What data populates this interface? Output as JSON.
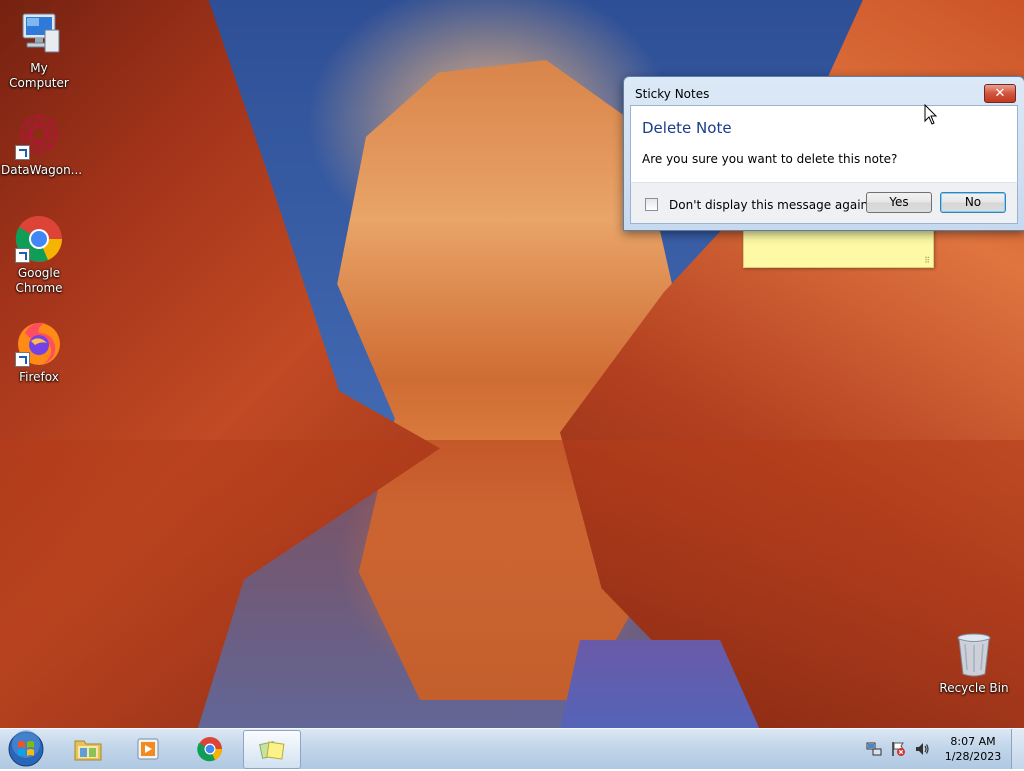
{
  "desktop": {
    "icons": [
      {
        "label": "My Computer"
      },
      {
        "label": "DataWagon..."
      },
      {
        "label": "Google Chrome"
      },
      {
        "label": "Firefox"
      },
      {
        "label": "Recycle Bin"
      }
    ]
  },
  "dialog": {
    "title": "Sticky Notes",
    "close_label": "✕",
    "heading": "Delete Note",
    "message": "Are you sure you want to delete this note?",
    "checkbox_label": "Don't display this message again",
    "checkbox_checked": false,
    "yes_label": "Yes",
    "no_label": "No"
  },
  "taskbar": {
    "pinned": [
      {
        "name": "windows-explorer",
        "icon": "folder-icon"
      },
      {
        "name": "media-player",
        "icon": "media-player-icon"
      },
      {
        "name": "google-chrome",
        "icon": "chrome-icon"
      },
      {
        "name": "sticky-notes",
        "icon": "sticky-notes-icon",
        "active": true
      }
    ],
    "tray": {
      "time": "8:07 AM",
      "date": "1/28/2023"
    }
  },
  "colors": {
    "taskbar": "#c2d6ea",
    "dialog_heading": "#1a3d8c",
    "sticky_note": "#fdf9a5",
    "close_button": "#c23a22"
  }
}
